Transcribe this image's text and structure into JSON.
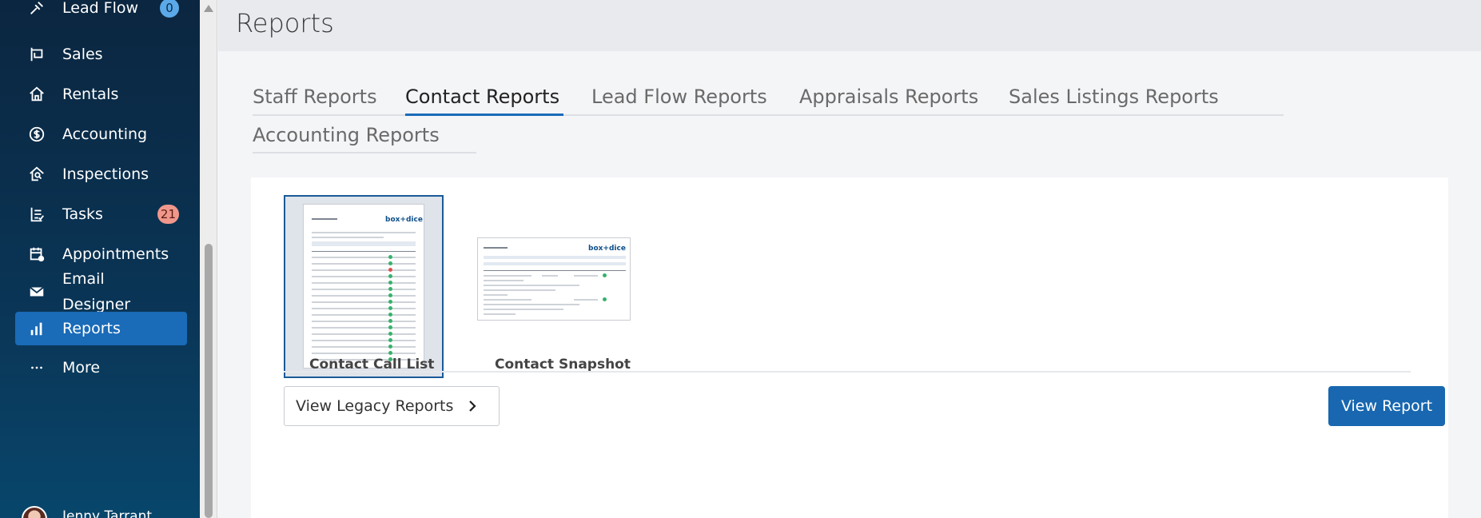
{
  "sidebar": {
    "items": [
      {
        "label": "Lead Flow",
        "icon": "lead-flow-icon",
        "badge": "0"
      },
      {
        "label": "Sales",
        "icon": "sales-sign-icon"
      },
      {
        "label": "Rentals",
        "icon": "house-icon"
      },
      {
        "label": "Accounting",
        "icon": "dollar-circle-icon"
      },
      {
        "label": "Inspections",
        "icon": "house-search-icon"
      },
      {
        "label": "Tasks",
        "icon": "task-list-icon",
        "badge": "21"
      },
      {
        "label": "Appointments",
        "icon": "calendar-icon"
      },
      {
        "label": "Email\nDesigner",
        "icon": "envelope-icon"
      },
      {
        "label": "Reports",
        "icon": "bar-chart-icon",
        "active": true
      },
      {
        "label": "More",
        "icon": "ellipsis-icon"
      }
    ],
    "user_name": "Jenny Tarrant"
  },
  "header": {
    "title": "Reports"
  },
  "tabs": [
    {
      "label": "Staff Reports"
    },
    {
      "label": "Contact Reports",
      "active": true
    },
    {
      "label": "Lead Flow Reports"
    },
    {
      "label": "Appraisals Reports"
    },
    {
      "label": "Sales Listings Reports"
    },
    {
      "label": "Accounting Reports"
    }
  ],
  "reports": [
    {
      "label": "Contact Call List",
      "selected": true
    },
    {
      "label": "Contact Snapshot"
    }
  ],
  "thumb_logo": "box+dice",
  "buttons": {
    "legacy": "View Legacy Reports",
    "view": "View Report"
  },
  "colors": {
    "accent": "#1a6bb8",
    "sidebar": "#0b2640"
  }
}
